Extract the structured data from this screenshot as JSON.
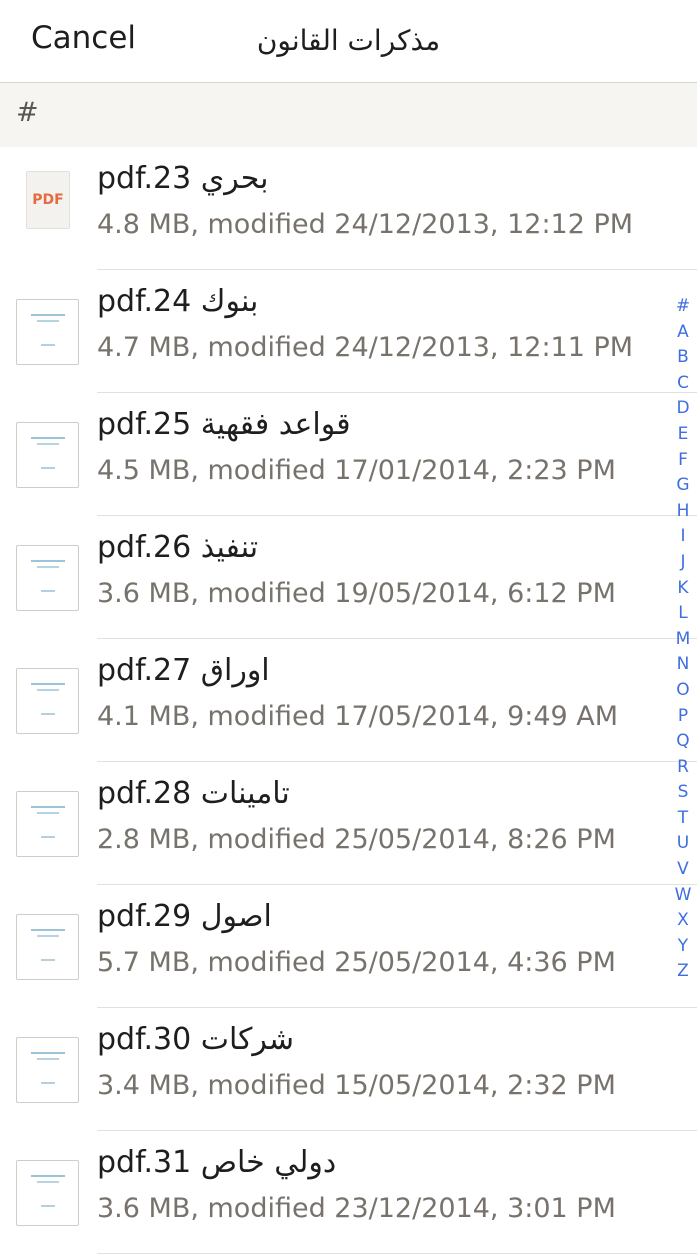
{
  "navbar": {
    "cancel_label": "Cancel",
    "title": "مذكرات القانون"
  },
  "section": {
    "header": "#"
  },
  "files": [
    {
      "name": "pdf.23 بحري",
      "meta": "4.8 MB, modified 24/12/2013, 12:12 PM",
      "icon": "pdf-icon"
    },
    {
      "name": "pdf.24 بنوك",
      "meta": "4.7 MB, modified 24/12/2013, 12:11 PM",
      "icon": "document-thumbnail"
    },
    {
      "name": "pdf.25 قواعد فقهية",
      "meta": "4.5 MB, modified 17/01/2014, 2:23 PM",
      "icon": "document-thumbnail"
    },
    {
      "name": "pdf.26 تنفيذ",
      "meta": "3.6 MB, modified 19/05/2014, 6:12 PM",
      "icon": "document-thumbnail"
    },
    {
      "name": "pdf.27 اوراق",
      "meta": "4.1 MB, modified 17/05/2014, 9:49 AM",
      "icon": "document-thumbnail"
    },
    {
      "name": "pdf.28 تامينات",
      "meta": "2.8 MB, modified 25/05/2014, 8:26 PM",
      "icon": "document-thumbnail"
    },
    {
      "name": "pdf.29 اصول",
      "meta": "5.7 MB, modified 25/05/2014, 4:36 PM",
      "icon": "document-thumbnail"
    },
    {
      "name": "pdf.30 شركات",
      "meta": "3.4 MB, modified 15/05/2014, 2:32 PM",
      "icon": "document-thumbnail"
    },
    {
      "name": "pdf.31 دولي خاص",
      "meta": "3.6 MB, modified 23/12/2014, 3:01 PM",
      "icon": "document-thumbnail"
    }
  ],
  "index_letters": [
    "#",
    "A",
    "B",
    "C",
    "D",
    "E",
    "F",
    "G",
    "H",
    "I",
    "J",
    "K",
    "L",
    "M",
    "N",
    "O",
    "P",
    "Q",
    "R",
    "S",
    "T",
    "U",
    "V",
    "W",
    "X",
    "Y",
    "Z"
  ],
  "colors": {
    "accent": "#3f6fde",
    "pdf_label": "#e56a3f",
    "section_bg": "#f7f5f2"
  }
}
